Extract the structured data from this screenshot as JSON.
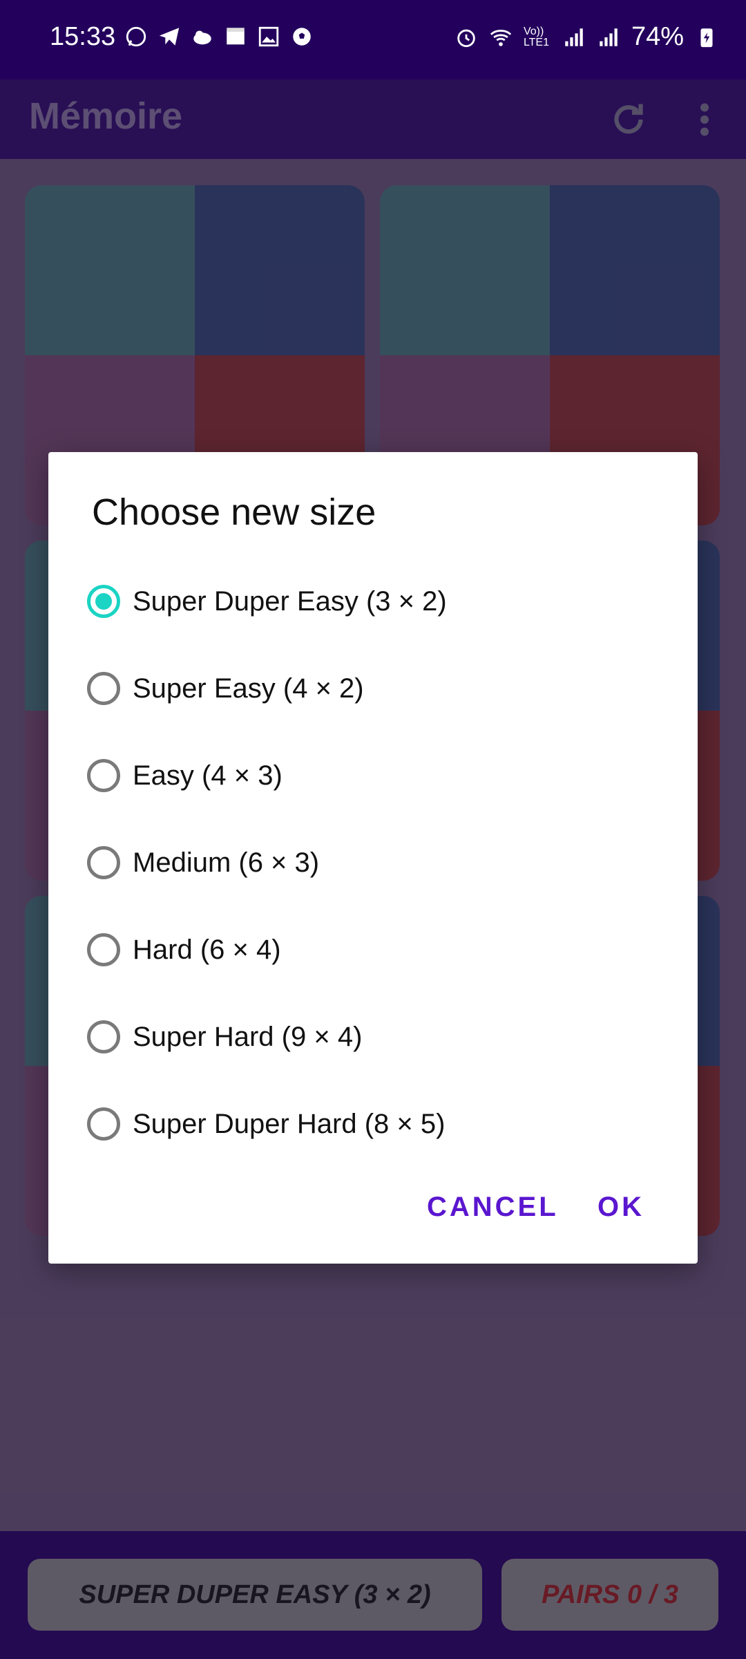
{
  "status_bar": {
    "time": "15:33",
    "battery": "74%",
    "net_label": "Vo)) LTE1",
    "left_icons": [
      "whatsapp-icon",
      "telegram-icon",
      "cloud-icon",
      "box-icon",
      "image-icon",
      "soccer-icon"
    ],
    "right_icons": [
      "alarm-icon",
      "wifi-icon",
      "signal-icon",
      "signal-icon",
      "battery-icon"
    ]
  },
  "app_bar": {
    "title": "Mémoire",
    "icons": [
      "refresh-icon",
      "more-vert-icon"
    ]
  },
  "dialog": {
    "title": "Choose new size",
    "options": [
      {
        "label": "Super Duper Easy (3 × 2)",
        "selected": true
      },
      {
        "label": "Super Easy (4 × 2)",
        "selected": false
      },
      {
        "label": "Easy (4 × 3)",
        "selected": false
      },
      {
        "label": "Medium (6 × 3)",
        "selected": false
      },
      {
        "label": "Hard (6 × 4)",
        "selected": false
      },
      {
        "label": "Super Hard (9 × 4)",
        "selected": false
      },
      {
        "label": "Super Duper Hard (8 × 5)",
        "selected": false
      }
    ],
    "cancel": "CANCEL",
    "ok": "OK"
  },
  "bottom_bar": {
    "difficulty": "SUPER DUPER EASY (3 × 2)",
    "pairs": "PAIRS 0 / 3"
  },
  "colors": {
    "status_bg": "#23005c",
    "accent_radio": "#1bd4c4",
    "dialog_button": "#5a16cf",
    "pairs_text": "#8a1a1a"
  }
}
